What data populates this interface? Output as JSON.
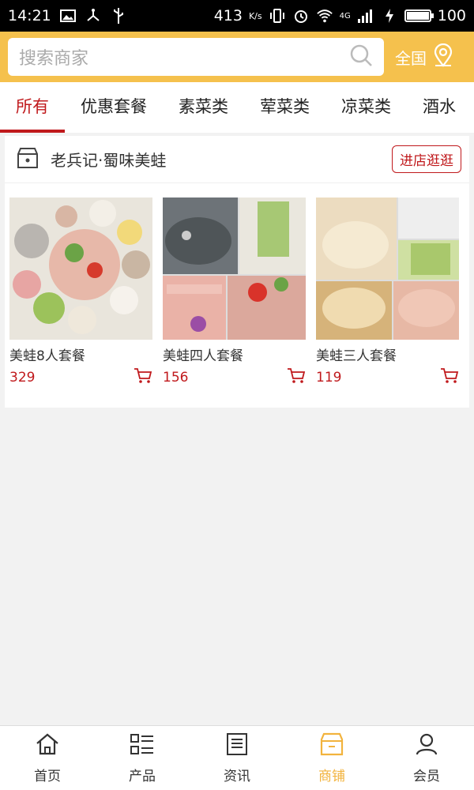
{
  "status_bar": {
    "time": "14:21",
    "net_speed": "413",
    "net_unit": "K/s",
    "network": "4G",
    "battery": "100"
  },
  "header": {
    "search_placeholder": "搜索商家",
    "region_label": "全国"
  },
  "tabs": [
    "所有",
    "优惠套餐",
    "素菜类",
    "荤菜类",
    "凉菜类",
    "酒水"
  ],
  "store": {
    "name": "老兵记·蜀味美蛙",
    "enter_label": "进店逛逛",
    "products": [
      {
        "name": "美蛙8人套餐",
        "price": "329"
      },
      {
        "name": "美蛙四人套餐",
        "price": "156"
      },
      {
        "name": "美蛙三人套餐",
        "price": "119"
      }
    ]
  },
  "bottom_nav": [
    {
      "label": "首页",
      "icon": "home-icon"
    },
    {
      "label": "产品",
      "icon": "list-icon"
    },
    {
      "label": "资讯",
      "icon": "news-icon"
    },
    {
      "label": "商铺",
      "icon": "store-icon"
    },
    {
      "label": "会员",
      "icon": "user-icon"
    }
  ],
  "colors": {
    "brand": "#f5c14d",
    "accent": "#c0191c",
    "nav_active": "#f2b33d"
  }
}
